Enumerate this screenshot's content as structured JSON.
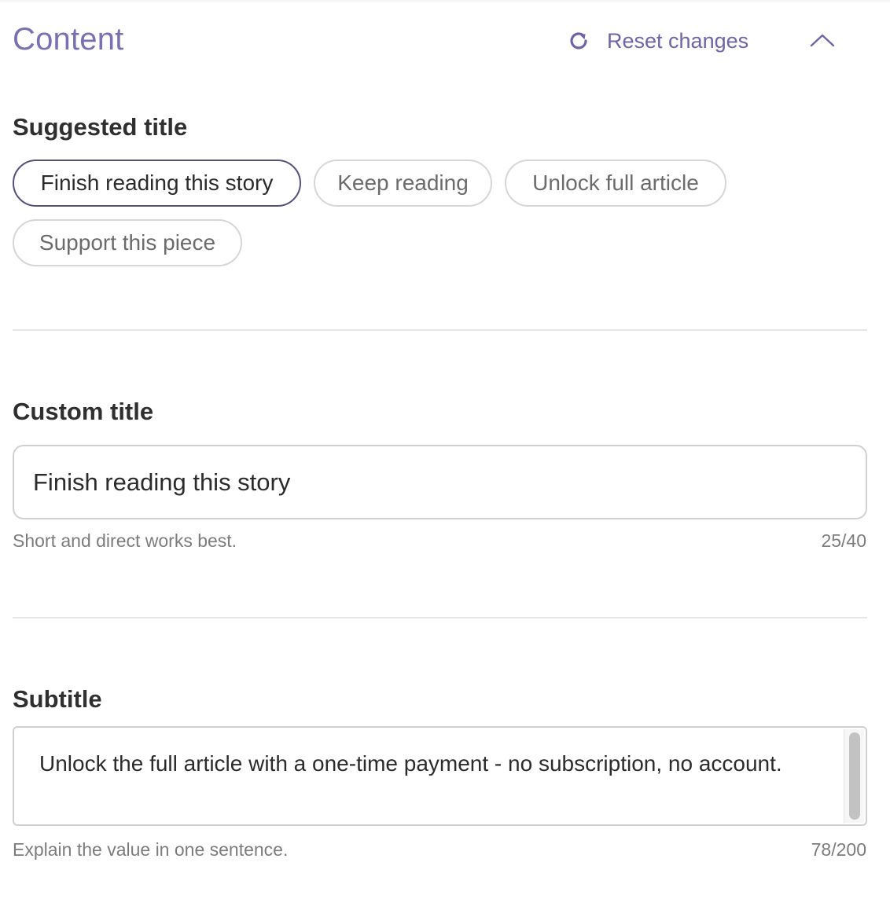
{
  "header": {
    "title": "Content",
    "reset_label": "Reset changes",
    "reset_icon": "refresh-icon",
    "collapse_icon": "chevron-up-icon",
    "accent_color": "#7c70b2"
  },
  "suggested": {
    "label": "Suggested title",
    "chips": [
      {
        "label": "Finish reading this story",
        "selected": true
      },
      {
        "label": "Keep reading",
        "selected": false
      },
      {
        "label": "Unlock full article",
        "selected": false
      },
      {
        "label": "Support this piece",
        "selected": false
      }
    ]
  },
  "custom_title": {
    "label": "Custom title",
    "value": "Finish reading this story",
    "hint": "Short and direct works best.",
    "counter": "25/40"
  },
  "subtitle": {
    "label": "Subtitle",
    "value": "Unlock the full article with a one-time payment - no subscription, no account.",
    "hint": "Explain the value in one sentence.",
    "counter": "78/200"
  }
}
